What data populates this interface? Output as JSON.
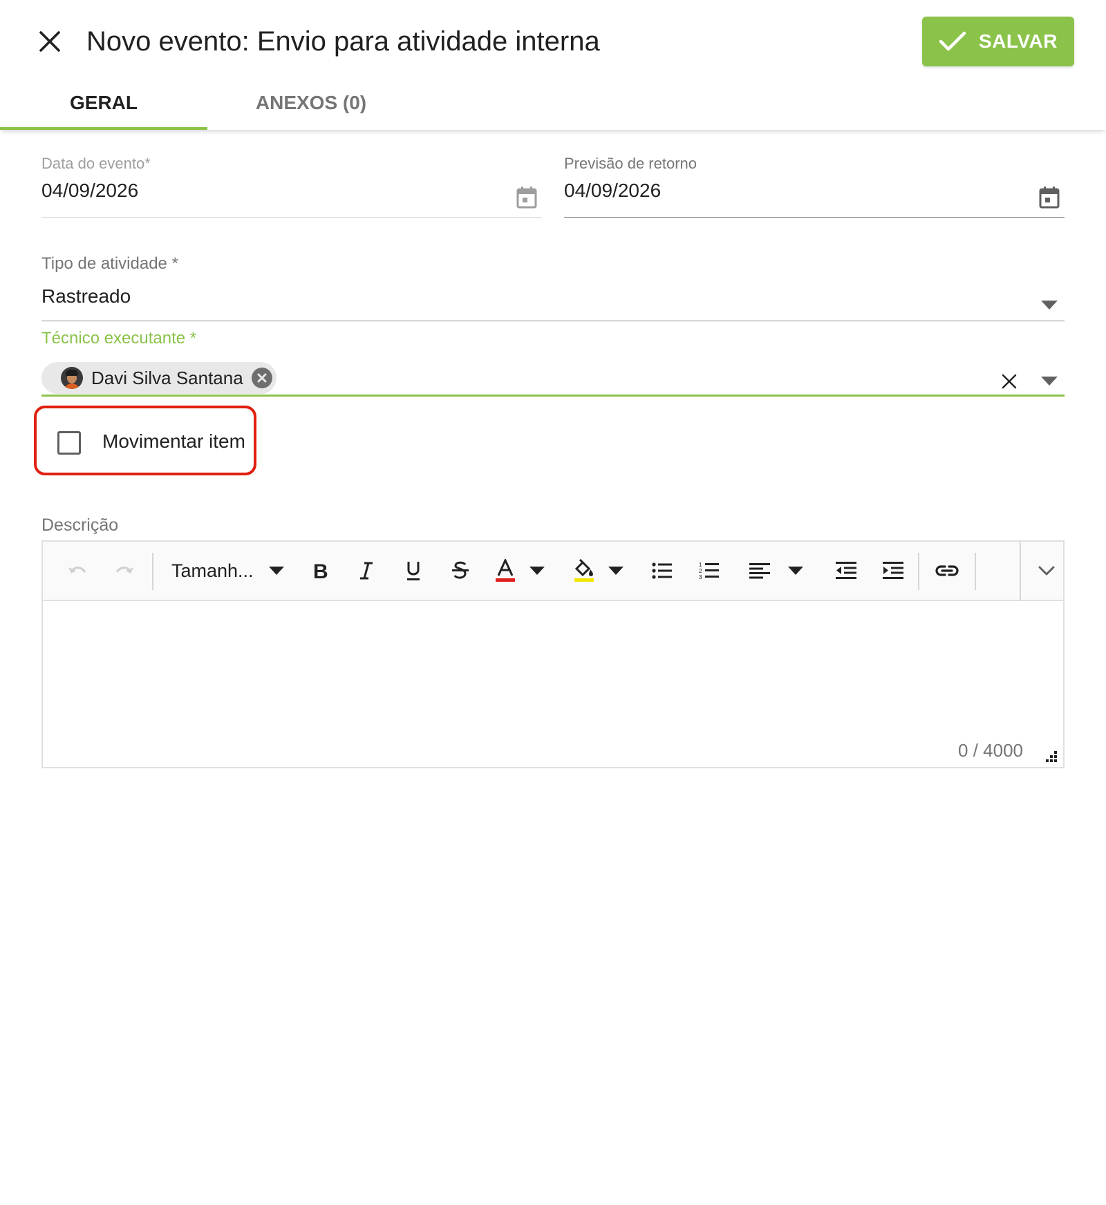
{
  "header": {
    "title": "Novo evento: Envio para atividade interna",
    "save_label": "SALVAR",
    "tabs": [
      {
        "label": "GERAL",
        "active": true
      },
      {
        "label": "ANEXOS (0)",
        "active": false
      }
    ]
  },
  "form": {
    "data_evento": {
      "label": "Data do evento*",
      "value": "04/09/2026"
    },
    "previsao_retorno": {
      "label": "Previsão de retorno",
      "value": "04/09/2026"
    },
    "tipo_atividade": {
      "label": "Tipo de atividade *",
      "value": "Rastreado"
    },
    "tecnico": {
      "label": "Técnico executante *",
      "chip": "Davi Silva Santana"
    },
    "movimentar": {
      "label": "Movimentar item",
      "checked": false
    },
    "descricao": {
      "label": "Descrição",
      "font_size_placeholder": "Tamanh...",
      "counter": "0 / 4000",
      "toolbar_icons": [
        "undo-icon",
        "redo-icon",
        "bold-icon",
        "italic-icon",
        "underline-icon",
        "strikethrough-icon",
        "font-color-icon",
        "highlight-icon",
        "bulleted-list-icon",
        "numbered-list-icon",
        "align-left-icon",
        "outdent-icon",
        "indent-icon",
        "link-icon",
        "chevron-down-icon"
      ]
    }
  },
  "colors": {
    "accent": "#8bc34a",
    "highlight_box": "#e02010",
    "font_color_bar": "#e02020",
    "highlight_color_bar": "#f0e600"
  }
}
